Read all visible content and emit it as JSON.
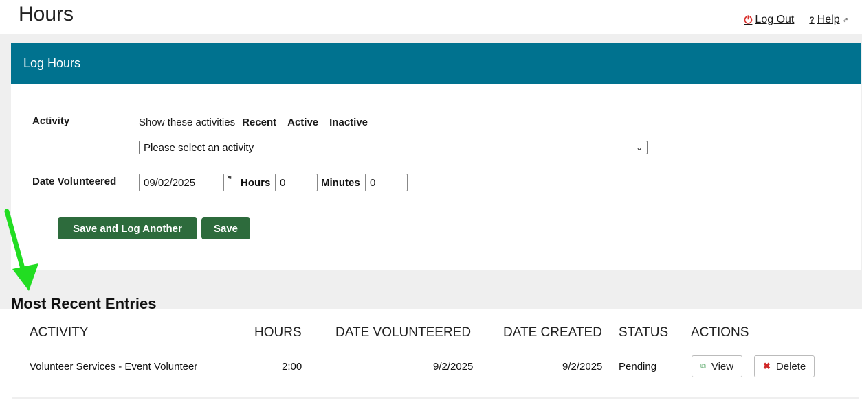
{
  "page": {
    "title": "Hours"
  },
  "top_links": {
    "logout": "Log Out",
    "help": "Help"
  },
  "panel": {
    "title": "Log Hours",
    "activity_label": "Activity",
    "show_label": "Show these activities",
    "filters": [
      "Recent",
      "Active",
      "Inactive"
    ],
    "activity_select_value": "Please select an activity",
    "date_label": "Date Volunteered",
    "date_value": "09/02/2025",
    "hours_label": "Hours",
    "hours_value": "0",
    "minutes_label": "Minutes",
    "minutes_value": "0",
    "save_another_label": "Save and Log Another",
    "save_label": "Save"
  },
  "recent": {
    "title": "Most Recent Entries",
    "columns": [
      "ACTIVITY",
      "HOURS",
      "DATE VOLUNTEERED",
      "DATE CREATED",
      "STATUS",
      "ACTIONS"
    ],
    "rows": [
      {
        "activity": "Volunteer Services - Event Volunteer",
        "hours": "2:00",
        "date_volunteered": "9/2/2025",
        "date_created": "9/2/2025",
        "status": "Pending",
        "view_label": "View",
        "delete_label": "Delete"
      }
    ]
  },
  "colors": {
    "header": "#00728f",
    "button": "#2d6b3c",
    "arrow": "#22dd22",
    "logout_icon": "#d9302c"
  },
  "icons": [
    "power-icon",
    "help-question-icon",
    "external-link-icon",
    "chevron-down-icon",
    "calendar-flag-icon",
    "view-icon",
    "delete-x-icon",
    "green-arrow-annotation"
  ]
}
